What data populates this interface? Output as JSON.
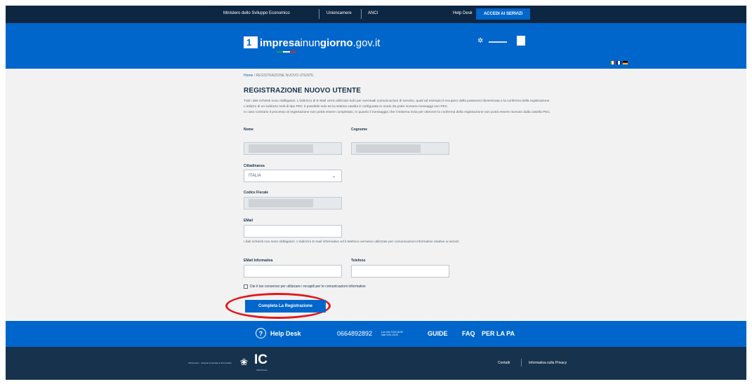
{
  "topbar": {
    "links": [
      "Ministero dello Sviluppo Economico",
      "Unioncamere",
      "ANCI"
    ],
    "helpdesk": "Help Desk",
    "access_button": "ACCEDI AI SERVIZI"
  },
  "header": {
    "logo_mark": "1",
    "logo_bold": "impresa",
    "logo_light": "inun",
    "logo_bold2": "giorno",
    "logo_domain": ".gov.it",
    "partner_star": "✲",
    "flags": [
      "it",
      "gb",
      "de"
    ]
  },
  "breadcrumb": {
    "home": "Home",
    "separator": "/",
    "current": "REGISTRAZIONE NUOVO UTENTE"
  },
  "page_title": "REGISTRAZIONE NUOVO UTENTE",
  "intro": [
    "Tutti i dati richiesti sono obbligatori. L'indirizzo di E-Mail verrà utilizzato solo per eventuali comunicazioni di servizio, quali ad esempio il recupero della password dimenticata e la conferma della registrazione.",
    "L'utilizzo di un indirizzo mail di tipo PEC è possibile solo se la relativa casella è configurata in modo da poter ricevere messaggi non PEC.",
    "In caso contrario il processo di registrazione non potrà essere completato, in quanto il messaggio che il sistema invia per ottenere la conferma della registrazione non potrà essere ricevuto dalla casella PEC."
  ],
  "form": {
    "nome_label": "Nome",
    "cognome_label": "Cognome",
    "cittadinanza_label": "Cittadinanza",
    "cittadinanza_value": "ITALIA",
    "codice_fiscale_label": "Codice Fiscale",
    "email_label": "EMail",
    "optional_note": "I dati richiesti non sono obbligatori. L'indirizzo E-mail informativo ed il telefono verranno utilizzate per comunicazioni informative relative ai servizi.",
    "email_info_label": "EMail Informativa",
    "telefono_label": "Telefono",
    "consent_label": "Dai il tuo consenso per utilizzare i recapiti per le comunicazioni informative",
    "submit_label": "Completa La Registrazione"
  },
  "helpbar": {
    "help_icon": "?",
    "help_label": "Help Desk",
    "phone": "0664892892",
    "phone_note_1": "Lun-Ven 9:00-18:00",
    "phone_note_2": "Sab 9:00-13:00",
    "links": [
      "GUIDE",
      "FAQ",
      "PER LA PA"
    ]
  },
  "footer": {
    "small_text": "InfoCamere · Società Consortile di Informatica",
    "emblem": "❀",
    "ic_logo": "IC",
    "ic_sub": "InfoCamere",
    "links": [
      "Contatti",
      "Informativa sulla Privacy"
    ]
  },
  "colors": {
    "primary": "#0066cc",
    "topbar": "#0d2642",
    "footer": "#17324d",
    "content_bg": "#f2f2f2",
    "highlight": "#e3161a"
  }
}
